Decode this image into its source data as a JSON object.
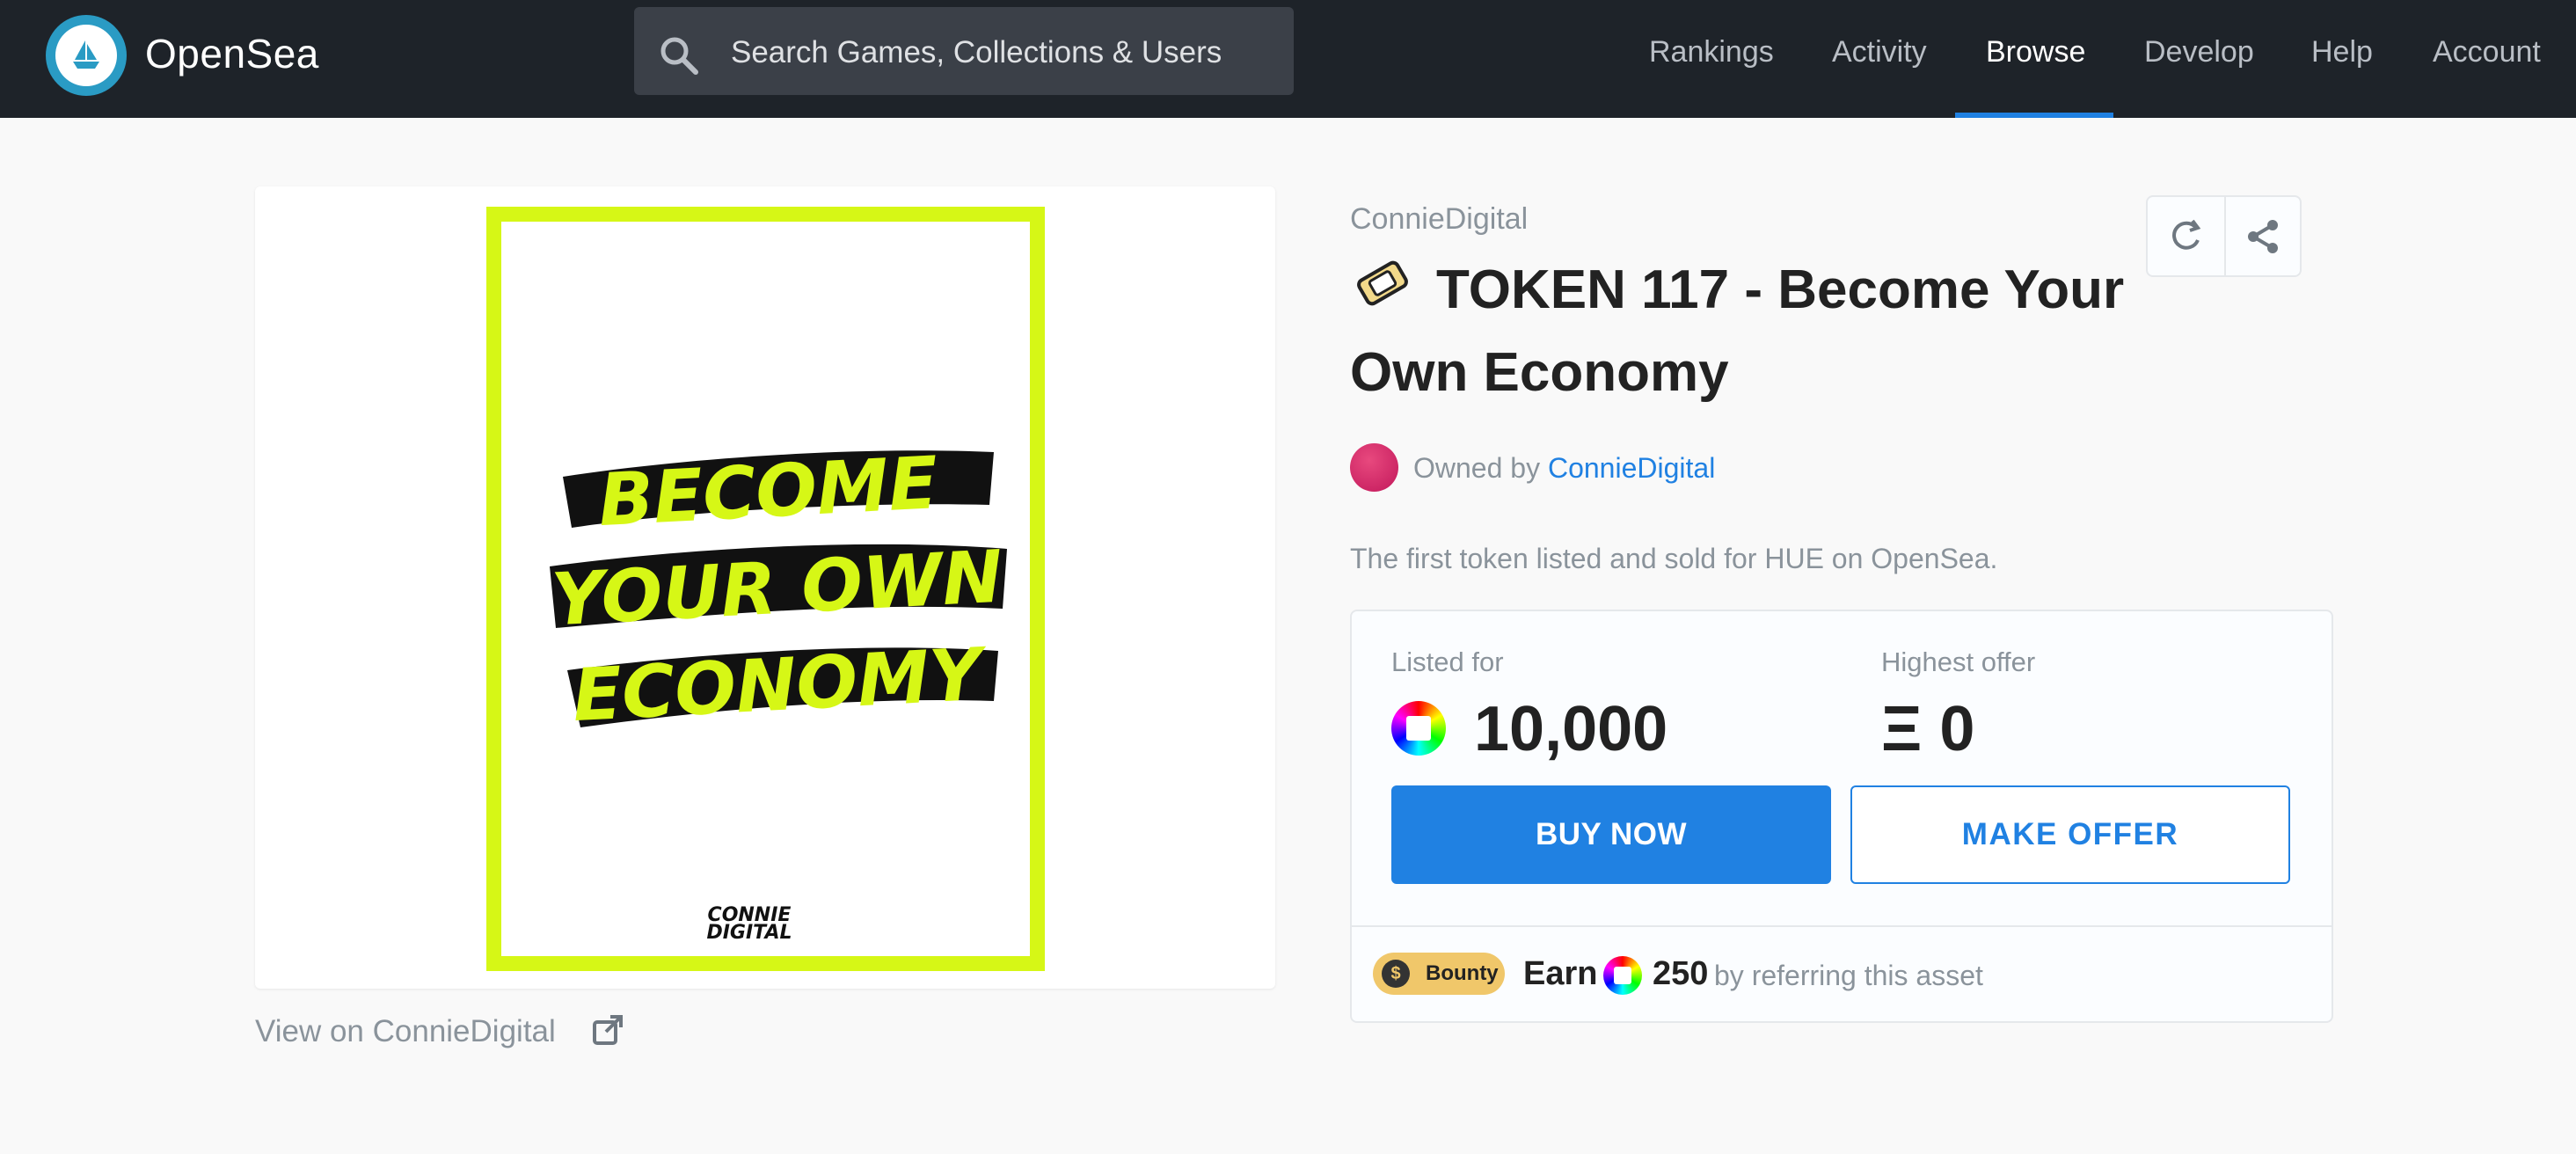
{
  "header": {
    "brand": "OpenSea",
    "search_placeholder": "Search Games, Collections & Users",
    "nav": [
      "Rankings",
      "Activity",
      "Browse",
      "Develop",
      "Help",
      "Account"
    ],
    "active_nav": "Browse"
  },
  "asset": {
    "image_text_lines": [
      "BECOME",
      "YOUR OWN",
      "ECONOMY"
    ],
    "image_signature_lines": [
      "CONNIE",
      "DIGITAL"
    ],
    "view_link": "View on ConnieDigital",
    "collection": "ConnieDigital",
    "title": "TOKEN 117 - Become Your Own Economy",
    "owned_by_label": "Owned by",
    "owner": "ConnieDigital",
    "description": "The first token listed and sold for HUE on OpenSea."
  },
  "pricing": {
    "listed_label": "Listed for",
    "listed_value": "10,000",
    "offer_label": "Highest offer",
    "offer_value": "Ξ 0",
    "buy_label": "BUY NOW",
    "offer_button_label": "MAKE OFFER",
    "bounty_badge": "Bounty",
    "bounty_coin_symbol": "$",
    "earn_label": "Earn",
    "earn_amount": "250",
    "earn_suffix": "by referring this asset"
  },
  "colors": {
    "navbar": "#1e2329",
    "accent": "#2081e2",
    "poster_lime": "#d6f716",
    "bounty": "#f0c76a"
  }
}
